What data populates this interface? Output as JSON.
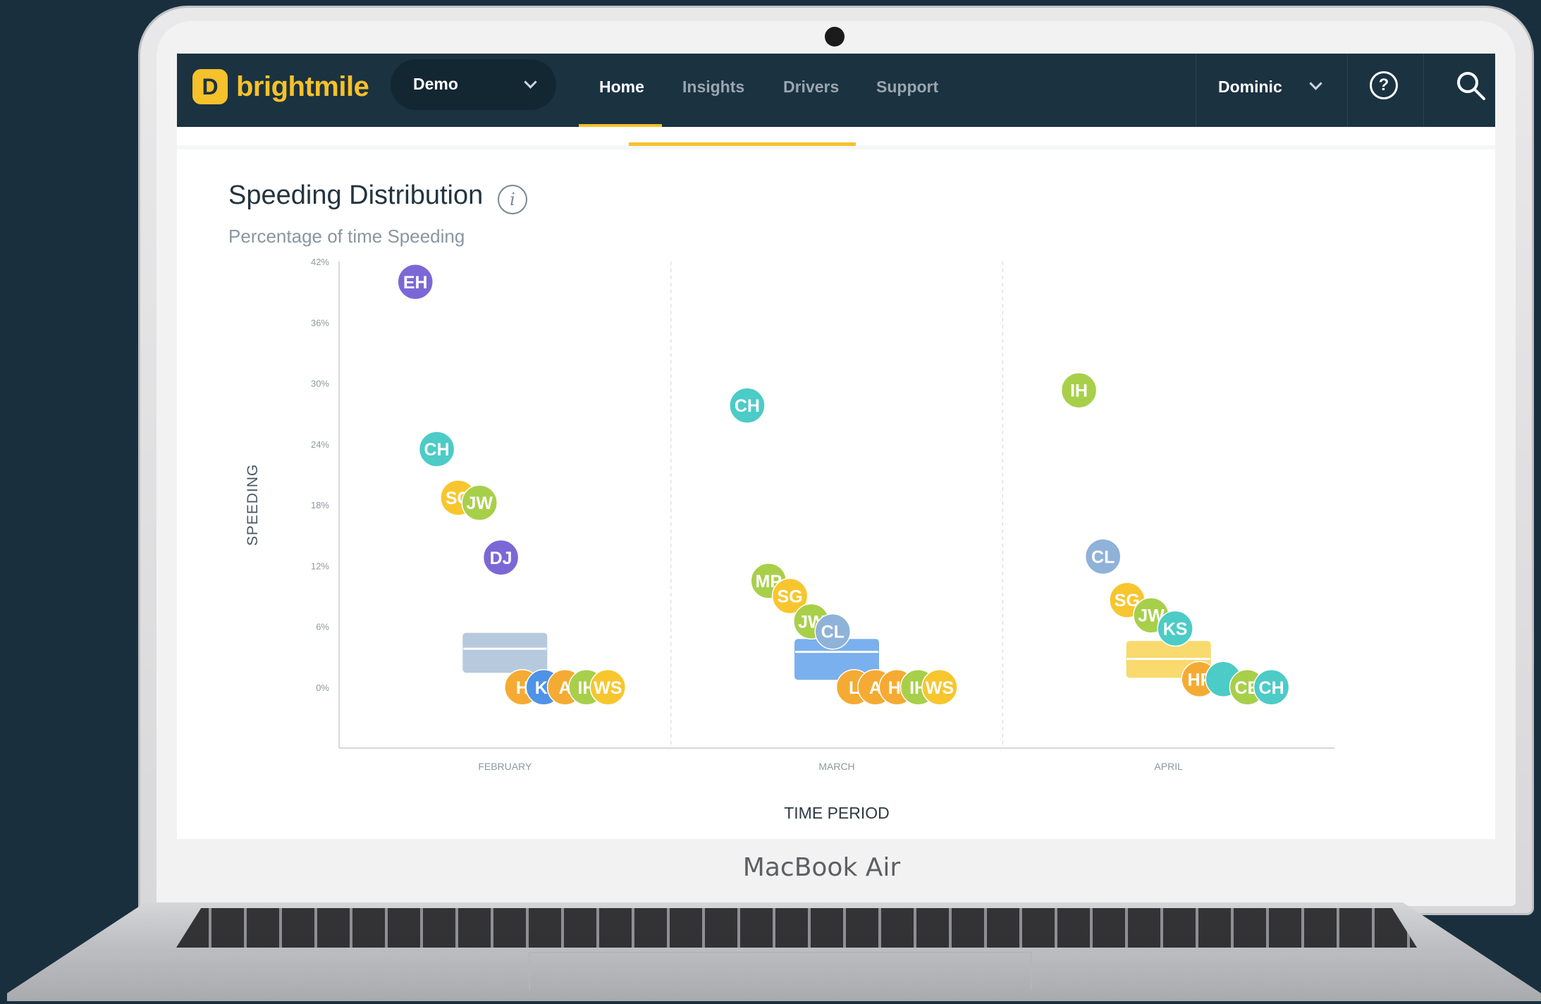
{
  "device_label": "MacBook Air",
  "nav": {
    "logo_text": "brightmile",
    "logo_glyph": "D",
    "workspace": "Demo",
    "links": [
      "Home",
      "Insights",
      "Drivers",
      "Support"
    ],
    "active_link": "Home",
    "user": "Dominic"
  },
  "icons": [
    "chevron-down-icon",
    "help-icon",
    "search-icon",
    "info-icon"
  ],
  "colors": {
    "nav_bg": "#1b3241",
    "accent": "#f6c12a"
  },
  "card": {
    "title": "Speeding Distribution",
    "subtitle": "Percentage of time Speeding",
    "info_glyph": "i"
  },
  "chart_data": {
    "type": "scatter",
    "ylabel": "SPEEDING",
    "xlabel": "TIME PERIOD",
    "yticks": [
      "42%",
      "36%",
      "30%",
      "24%",
      "18%",
      "12%",
      "6%",
      "0%"
    ],
    "ylim": [
      -6,
      42
    ],
    "categories": [
      "FEBRUARY",
      "MARCH",
      "APRIL"
    ],
    "box_colors": [
      "#b7c9dc",
      "#7ab0ee",
      "#f8da6e"
    ],
    "boxes": [
      {
        "category": "FEBRUARY",
        "q1": 1.5,
        "median": 3.8,
        "q3": 5.3
      },
      {
        "category": "MARCH",
        "q1": 0.8,
        "median": 3.5,
        "q3": 4.7
      },
      {
        "category": "APRIL",
        "q1": 1.0,
        "median": 2.8,
        "q3": 4.5
      }
    ],
    "points": [
      {
        "category": "FEBRUARY",
        "label": "EH",
        "y": 40.0,
        "color": "#7b68d6"
      },
      {
        "category": "FEBRUARY",
        "label": "CH",
        "y": 23.5,
        "color": "#4ccbc7"
      },
      {
        "category": "FEBRUARY",
        "label": "SG",
        "y": 18.7,
        "color": "#f7c62f"
      },
      {
        "category": "FEBRUARY",
        "label": "JW",
        "y": 18.2,
        "color": "#a8cf4a"
      },
      {
        "category": "FEBRUARY",
        "label": "DJ",
        "y": 12.8,
        "color": "#7b68d6"
      },
      {
        "category": "FEBRUARY",
        "label": "H",
        "y": 0.0,
        "color": "#f5ab33"
      },
      {
        "category": "FEBRUARY",
        "label": "KI",
        "y": 0.0,
        "color": "#4f93e8"
      },
      {
        "category": "FEBRUARY",
        "label": "A",
        "y": 0.0,
        "color": "#f5ab33"
      },
      {
        "category": "FEBRUARY",
        "label": "IH",
        "y": 0.0,
        "color": "#a8cf4a"
      },
      {
        "category": "FEBRUARY",
        "label": "WS",
        "y": 0.0,
        "color": "#f7c62f"
      },
      {
        "category": "MARCH",
        "label": "CH",
        "y": 27.8,
        "color": "#4ccbc7"
      },
      {
        "category": "MARCH",
        "label": "MP",
        "y": 10.5,
        "color": "#a8cf4a"
      },
      {
        "category": "MARCH",
        "label": "SG",
        "y": 9.0,
        "color": "#f7c62f"
      },
      {
        "category": "MARCH",
        "label": "JW",
        "y": 6.5,
        "color": "#a8cf4a"
      },
      {
        "category": "MARCH",
        "label": "CL",
        "y": 5.5,
        "color": "#8fb2d8"
      },
      {
        "category": "MARCH",
        "label": "L",
        "y": 0.0,
        "color": "#f5ab33"
      },
      {
        "category": "MARCH",
        "label": "A",
        "y": 0.0,
        "color": "#f5ab33"
      },
      {
        "category": "MARCH",
        "label": "HI",
        "y": 0.0,
        "color": "#f5ab33"
      },
      {
        "category": "MARCH",
        "label": "IH",
        "y": 0.0,
        "color": "#a8cf4a"
      },
      {
        "category": "MARCH",
        "label": "WS",
        "y": 0.0,
        "color": "#f7c62f"
      },
      {
        "category": "APRIL",
        "label": "IH",
        "y": 29.3,
        "color": "#a8cf4a"
      },
      {
        "category": "APRIL",
        "label": "CL",
        "y": 12.9,
        "color": "#8fb2d8"
      },
      {
        "category": "APRIL",
        "label": "SG",
        "y": 8.6,
        "color": "#f7c62f"
      },
      {
        "category": "APRIL",
        "label": "JW",
        "y": 7.1,
        "color": "#a8cf4a"
      },
      {
        "category": "APRIL",
        "label": "KS",
        "y": 5.8,
        "color": "#4ccbc7"
      },
      {
        "category": "APRIL",
        "label": "HF",
        "y": 0.8,
        "color": "#f5ab33"
      },
      {
        "category": "APRIL",
        "label": "",
        "y": 0.8,
        "color": "#4ccbc7"
      },
      {
        "category": "APRIL",
        "label": "CB",
        "y": 0.0,
        "color": "#a8cf4a"
      },
      {
        "category": "APRIL",
        "label": "CH",
        "y": 0.0,
        "color": "#4ccbc7"
      }
    ]
  }
}
